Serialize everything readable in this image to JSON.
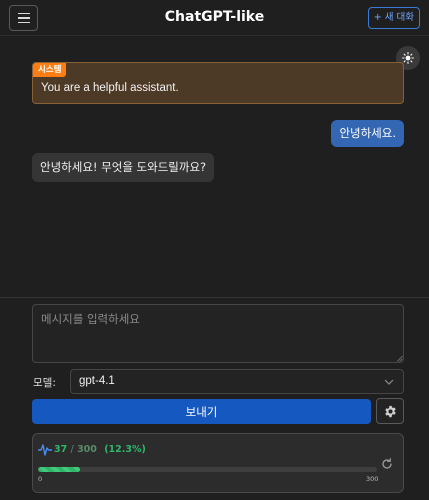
{
  "header": {
    "title": "ChatGPT-like",
    "new_chat_label": "+ 새 대화",
    "menu_icon": "hamburger-menu-icon"
  },
  "theme_toggle": {
    "icon": "sun-icon"
  },
  "messages": {
    "system": {
      "badge": "시스템",
      "text": "You are a helpful assistant."
    },
    "user": {
      "text": "안녕하세요."
    },
    "assistant": {
      "text": "안녕하세요! 무엇을 도와드릴까요?"
    }
  },
  "composer": {
    "placeholder": "메시지를 입력하세요",
    "model_label": "모델:",
    "model_value": "gpt-4.1",
    "send_label": "보내기",
    "settings_icon": "gear-icon"
  },
  "tokens": {
    "used": "37",
    "separator": "/",
    "max": "300",
    "percent_label": "(12.3%)",
    "fraction": 0.123,
    "axis_min": "0",
    "axis_max": "300"
  },
  "colors": {
    "accent": "#1558c0",
    "user_bubble": "#3366b3",
    "system_badge": "#fd7e14",
    "token_green": "#2fb66a"
  }
}
